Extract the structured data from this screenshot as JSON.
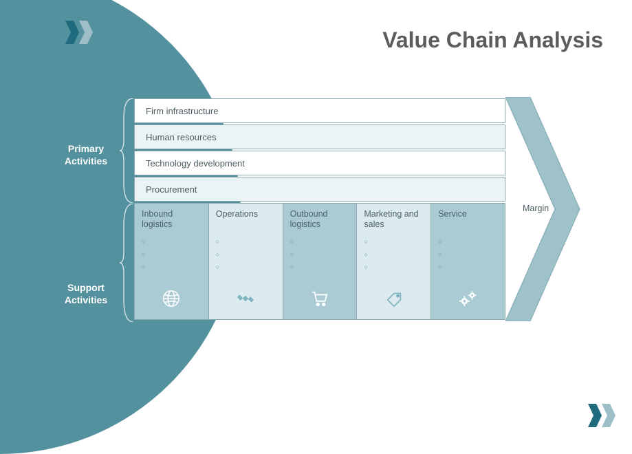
{
  "title": "Value Chain Analysis",
  "labels": {
    "primary": "Primary Activities",
    "support": "Support Activities",
    "margin": "Margin"
  },
  "support_activities": [
    {
      "name": "Firm infrastructure",
      "tint": false
    },
    {
      "name": "Human resources",
      "tint": true
    },
    {
      "name": "Technology development",
      "tint": false
    },
    {
      "name": "Procurement",
      "tint": true
    }
  ],
  "primary_activities": [
    {
      "name": "Inbound logistics",
      "icon": "globe-icon",
      "shade": "a"
    },
    {
      "name": "Operations",
      "icon": "satellite-icon",
      "shade": "b"
    },
    {
      "name": "Outbound logistics",
      "icon": "cart-icon",
      "shade": "a"
    },
    {
      "name": "Marketing and sales",
      "icon": "tag-icon",
      "shade": "b"
    },
    {
      "name": "Service",
      "icon": "gears-icon",
      "shade": "a"
    }
  ],
  "chart_data": {
    "type": "table",
    "title": "Value Chain Analysis",
    "support_activities": [
      "Firm infrastructure",
      "Human resources",
      "Technology development",
      "Procurement"
    ],
    "primary_activities": [
      "Inbound logistics",
      "Operations",
      "Outbound logistics",
      "Marketing and sales",
      "Service"
    ],
    "output": "Margin"
  },
  "colors": {
    "brand": "#54919f",
    "accent_light": "#aacbd3",
    "accent_pale": "#dcebef",
    "text_heading": "#5c5c5c"
  }
}
